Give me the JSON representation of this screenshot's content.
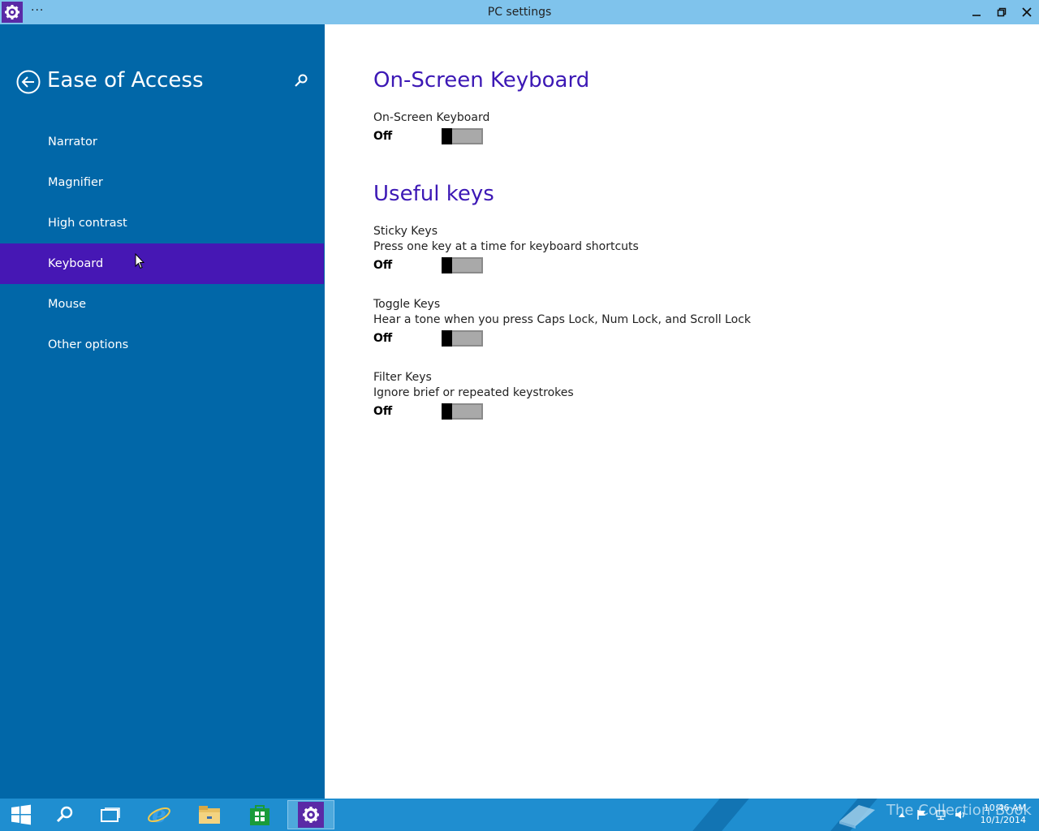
{
  "window": {
    "title": "PC settings",
    "menu_dots": "···"
  },
  "sidebar": {
    "title": "Ease of Access",
    "items": [
      {
        "label": "Narrator"
      },
      {
        "label": "Magnifier"
      },
      {
        "label": "High contrast"
      },
      {
        "label": "Keyboard",
        "active": true
      },
      {
        "label": "Mouse"
      },
      {
        "label": "Other options"
      }
    ]
  },
  "content": {
    "onscreen_section": "On-Screen Keyboard",
    "useful_section": "Useful keys",
    "settings": {
      "onscreen": {
        "label": "On-Screen Keyboard",
        "state": "Off"
      },
      "sticky": {
        "label": "Sticky Keys",
        "desc": "Press one key at a time for keyboard shortcuts",
        "state": "Off"
      },
      "toggle": {
        "label": "Toggle Keys",
        "desc": "Hear a tone when you press Caps Lock, Num Lock, and Scroll Lock",
        "state": "Off"
      },
      "filter": {
        "label": "Filter Keys",
        "desc": "Ignore brief or repeated keystrokes",
        "state": "Off"
      }
    }
  },
  "taskbar": {
    "watermark": "The Collection Book",
    "time": "10:46 AM",
    "date": "10/1/2014"
  },
  "colors": {
    "sidebar": "#0167a8",
    "active_item": "#4617b4",
    "accent_text": "#3c18b5",
    "titlebar": "#7fc3ec",
    "taskbar": "#1f8ed0"
  }
}
